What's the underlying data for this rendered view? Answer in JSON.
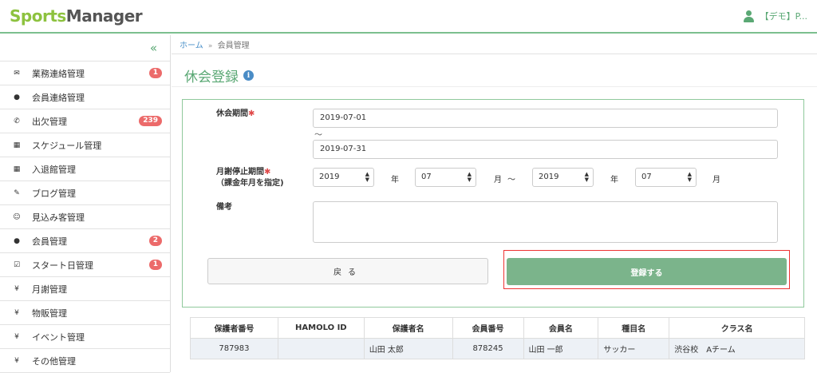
{
  "logo": {
    "part1": "Sports",
    "part2": "Manager"
  },
  "user": {
    "name": "【デモ】P..."
  },
  "sidebar": {
    "collapse_label": "«",
    "items": [
      {
        "label": "業務連絡管理",
        "icon": "envelope-icon",
        "glyph": "✉",
        "badge": "1"
      },
      {
        "label": "会員連絡管理",
        "icon": "comment-icon",
        "glyph": "●",
        "badge": ""
      },
      {
        "label": "出欠管理",
        "icon": "phone-icon",
        "glyph": "✆",
        "badge": "239"
      },
      {
        "label": "スケジュール管理",
        "icon": "calendar-icon",
        "glyph": "▦",
        "badge": ""
      },
      {
        "label": "入退館管理",
        "icon": "calendar-icon",
        "glyph": "▦",
        "badge": ""
      },
      {
        "label": "ブログ管理",
        "icon": "pencil-icon",
        "glyph": "✎",
        "badge": ""
      },
      {
        "label": "見込み客管理",
        "icon": "smile-icon",
        "glyph": "☺",
        "badge": ""
      },
      {
        "label": "会員管理",
        "icon": "user-icon",
        "glyph": "●",
        "badge": "2"
      },
      {
        "label": "スタート日管理",
        "icon": "check-square-icon",
        "glyph": "☑",
        "badge": "1"
      },
      {
        "label": "月謝管理",
        "icon": "yen-icon",
        "glyph": "¥",
        "badge": ""
      },
      {
        "label": "物販管理",
        "icon": "yen-icon",
        "glyph": "¥",
        "badge": ""
      },
      {
        "label": "イベント管理",
        "icon": "yen-icon",
        "glyph": "¥",
        "badge": ""
      },
      {
        "label": "その他管理",
        "icon": "yen-icon",
        "glyph": "¥",
        "badge": ""
      }
    ]
  },
  "breadcrumb": {
    "home": "ホーム",
    "sep": "»",
    "current": "会員管理"
  },
  "page": {
    "title": "休会登録",
    "info_glyph": "i"
  },
  "form": {
    "period_label": "休会期間",
    "required_mark": "✱",
    "period_start": "2019-07-01",
    "tilde": "～",
    "period_end": "2019-07-31",
    "fee_label_1": "月謝停止期間",
    "fee_label_2": "（課金年月を指定)",
    "from_year": "2019",
    "year_unit": "年",
    "from_month": "07",
    "month_unit": "月",
    "range_sep": "～",
    "to_year": "2019",
    "to_month": "07",
    "notes_label": "備考",
    "notes_value": "",
    "back_label": "戻る",
    "submit_label": "登録する"
  },
  "table": {
    "headers": [
      "保護者番号",
      "HAMOLO ID",
      "保護者名",
      "会員番号",
      "会員名",
      "種目名",
      "クラス名"
    ],
    "rows": [
      [
        "787983",
        "",
        "山田 太郎",
        "878245",
        "山田 一郎",
        "サッカー",
        "渋谷校　Aチーム"
      ]
    ]
  }
}
